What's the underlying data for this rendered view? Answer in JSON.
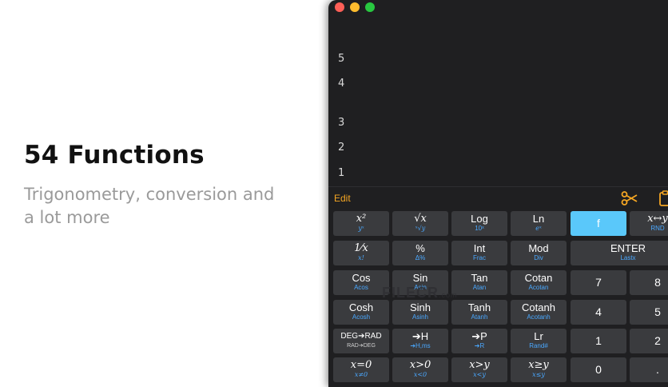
{
  "promo": {
    "headline": "54 Functions",
    "subhead": "Trigonometry, conversion and a lot more"
  },
  "window": {
    "traffic_lights": [
      "close",
      "minimize",
      "zoom"
    ],
    "colors": {
      "background": "#1f1f21",
      "key": "#3a3b3e",
      "accent": "#5ac8fa",
      "sublabel": "#4aa8ff",
      "edit": "#f5a623"
    }
  },
  "stack": [
    "5",
    "4",
    "3",
    "2",
    "1"
  ],
  "toolbar": {
    "edit_label": "Edit",
    "icons": [
      "scissors-icon",
      "clipboard-icon"
    ]
  },
  "keys": {
    "square": {
      "main": "x²",
      "sub": "yˣ"
    },
    "sqrt": {
      "main": "√x",
      "sub": "ˣ√y"
    },
    "log": {
      "main": "Log",
      "sub": "10ˣ"
    },
    "ln": {
      "main": "Ln",
      "sub": "eˣ"
    },
    "f": {
      "main": "f"
    },
    "swap": {
      "main": "x↔y",
      "sub": "RND"
    },
    "reciprocal": {
      "main": "1⁄x",
      "sub": "x!"
    },
    "percent": {
      "main": "%",
      "sub": "Δ%"
    },
    "int": {
      "main": "Int",
      "sub": "Frac"
    },
    "mod": {
      "main": "Mod",
      "sub": "Div"
    },
    "enter": {
      "main": "ENTER",
      "sub": "Lastx"
    },
    "cos": {
      "main": "Cos",
      "sub": "Acos"
    },
    "sin": {
      "main": "Sin",
      "sub": "Asin"
    },
    "tan": {
      "main": "Tan",
      "sub": "Atan"
    },
    "cotan": {
      "main": "Cotan",
      "sub": "Acotan"
    },
    "cosh": {
      "main": "Cosh",
      "sub": "Acosh"
    },
    "sinh": {
      "main": "Sinh",
      "sub": "Asinh"
    },
    "tanh": {
      "main": "Tanh",
      "sub": "Atanh"
    },
    "cotanh": {
      "main": "Cotanh",
      "sub": "Acotanh"
    },
    "deg_rad": {
      "main": "DEG➔RAD",
      "sub": "RAD➔DEG"
    },
    "to_h": {
      "main": "➔H",
      "sub": "➔H,ms"
    },
    "to_p": {
      "main": "➔P",
      "sub": "➔R"
    },
    "lr": {
      "main": "Lr",
      "sub": "Rand#"
    },
    "x_eq_0": {
      "main": "x=0",
      "sub": "x≠0"
    },
    "x_gt_0": {
      "main": "x>0",
      "sub": "x<0"
    },
    "x_gt_y": {
      "main": "x>y",
      "sub": "x<y"
    },
    "x_ge_y": {
      "main": "x≥y",
      "sub": "x≤y"
    },
    "d7": {
      "main": "7"
    },
    "d8": {
      "main": "8"
    },
    "d4": {
      "main": "4"
    },
    "d5": {
      "main": "5"
    },
    "d1": {
      "main": "1"
    },
    "d2": {
      "main": "2"
    },
    "d0": {
      "main": "0"
    },
    "dot": {
      "main": "."
    }
  },
  "watermark": {
    "text": "FILECR",
    "domain": ".com"
  }
}
